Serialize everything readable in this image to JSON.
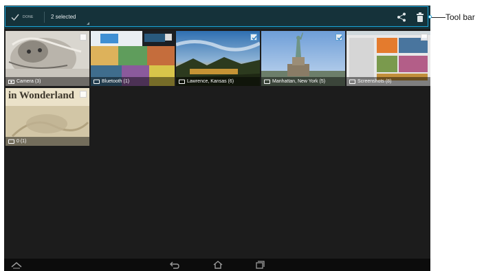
{
  "actionbar": {
    "done_label": "DONE",
    "selected_label": "2 selected",
    "share_icon": "share-icon",
    "delete_icon": "trash-icon"
  },
  "albums": [
    {
      "label": "Camera (3)",
      "icon": "camera-icon",
      "checked": false
    },
    {
      "label": "Bluetooth (1)",
      "icon": "folder-icon",
      "checked": false
    },
    {
      "label": "Lawrence, Kansas (6)",
      "icon": "folder-icon",
      "checked": true
    },
    {
      "label": "Manhattan, New York (5)",
      "icon": "folder-icon",
      "checked": true
    },
    {
      "label": "Screenshots (8)",
      "icon": "folder-icon",
      "checked": false
    },
    {
      "label": "0 (1)",
      "icon": "folder-icon",
      "checked": false
    }
  ],
  "album6_text": "in Wonderland",
  "navbar": {
    "up_icon": "chevron-up-icon",
    "back_icon": "back-icon",
    "home_icon": "home-icon",
    "recents_icon": "recent-apps-icon"
  },
  "callout": {
    "label": "Tool bar"
  },
  "colors": {
    "actionbar_bg": "#15323a",
    "highlight": "#1aa4d8",
    "screen_bg": "#1c1c1c"
  }
}
